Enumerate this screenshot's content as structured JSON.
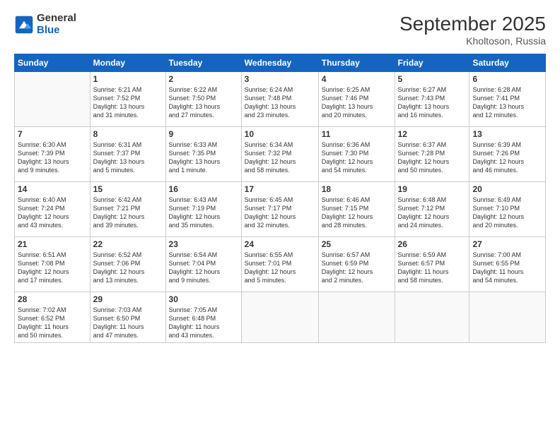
{
  "logo": {
    "general": "General",
    "blue": "Blue"
  },
  "header": {
    "month": "September 2025",
    "location": "Kholtoson, Russia"
  },
  "weekdays": [
    "Sunday",
    "Monday",
    "Tuesday",
    "Wednesday",
    "Thursday",
    "Friday",
    "Saturday"
  ],
  "weeks": [
    [
      {
        "day": "",
        "info": ""
      },
      {
        "day": "1",
        "info": "Sunrise: 6:21 AM\nSunset: 7:52 PM\nDaylight: 13 hours\nand 31 minutes."
      },
      {
        "day": "2",
        "info": "Sunrise: 6:22 AM\nSunset: 7:50 PM\nDaylight: 13 hours\nand 27 minutes."
      },
      {
        "day": "3",
        "info": "Sunrise: 6:24 AM\nSunset: 7:48 PM\nDaylight: 13 hours\nand 23 minutes."
      },
      {
        "day": "4",
        "info": "Sunrise: 6:25 AM\nSunset: 7:46 PM\nDaylight: 13 hours\nand 20 minutes."
      },
      {
        "day": "5",
        "info": "Sunrise: 6:27 AM\nSunset: 7:43 PM\nDaylight: 13 hours\nand 16 minutes."
      },
      {
        "day": "6",
        "info": "Sunrise: 6:28 AM\nSunset: 7:41 PM\nDaylight: 13 hours\nand 12 minutes."
      }
    ],
    [
      {
        "day": "7",
        "info": "Sunrise: 6:30 AM\nSunset: 7:39 PM\nDaylight: 13 hours\nand 9 minutes."
      },
      {
        "day": "8",
        "info": "Sunrise: 6:31 AM\nSunset: 7:37 PM\nDaylight: 13 hours\nand 5 minutes."
      },
      {
        "day": "9",
        "info": "Sunrise: 6:33 AM\nSunset: 7:35 PM\nDaylight: 13 hours\nand 1 minute."
      },
      {
        "day": "10",
        "info": "Sunrise: 6:34 AM\nSunset: 7:32 PM\nDaylight: 12 hours\nand 58 minutes."
      },
      {
        "day": "11",
        "info": "Sunrise: 6:36 AM\nSunset: 7:30 PM\nDaylight: 12 hours\nand 54 minutes."
      },
      {
        "day": "12",
        "info": "Sunrise: 6:37 AM\nSunset: 7:28 PM\nDaylight: 12 hours\nand 50 minutes."
      },
      {
        "day": "13",
        "info": "Sunrise: 6:39 AM\nSunset: 7:26 PM\nDaylight: 12 hours\nand 46 minutes."
      }
    ],
    [
      {
        "day": "14",
        "info": "Sunrise: 6:40 AM\nSunset: 7:24 PM\nDaylight: 12 hours\nand 43 minutes."
      },
      {
        "day": "15",
        "info": "Sunrise: 6:42 AM\nSunset: 7:21 PM\nDaylight: 12 hours\nand 39 minutes."
      },
      {
        "day": "16",
        "info": "Sunrise: 6:43 AM\nSunset: 7:19 PM\nDaylight: 12 hours\nand 35 minutes."
      },
      {
        "day": "17",
        "info": "Sunrise: 6:45 AM\nSunset: 7:17 PM\nDaylight: 12 hours\nand 32 minutes."
      },
      {
        "day": "18",
        "info": "Sunrise: 6:46 AM\nSunset: 7:15 PM\nDaylight: 12 hours\nand 28 minutes."
      },
      {
        "day": "19",
        "info": "Sunrise: 6:48 AM\nSunset: 7:12 PM\nDaylight: 12 hours\nand 24 minutes."
      },
      {
        "day": "20",
        "info": "Sunrise: 6:49 AM\nSunset: 7:10 PM\nDaylight: 12 hours\nand 20 minutes."
      }
    ],
    [
      {
        "day": "21",
        "info": "Sunrise: 6:51 AM\nSunset: 7:08 PM\nDaylight: 12 hours\nand 17 minutes."
      },
      {
        "day": "22",
        "info": "Sunrise: 6:52 AM\nSunset: 7:06 PM\nDaylight: 12 hours\nand 13 minutes."
      },
      {
        "day": "23",
        "info": "Sunrise: 6:54 AM\nSunset: 7:04 PM\nDaylight: 12 hours\nand 9 minutes."
      },
      {
        "day": "24",
        "info": "Sunrise: 6:55 AM\nSunset: 7:01 PM\nDaylight: 12 hours\nand 5 minutes."
      },
      {
        "day": "25",
        "info": "Sunrise: 6:57 AM\nSunset: 6:59 PM\nDaylight: 12 hours\nand 2 minutes."
      },
      {
        "day": "26",
        "info": "Sunrise: 6:59 AM\nSunset: 6:57 PM\nDaylight: 11 hours\nand 58 minutes."
      },
      {
        "day": "27",
        "info": "Sunrise: 7:00 AM\nSunset: 6:55 PM\nDaylight: 11 hours\nand 54 minutes."
      }
    ],
    [
      {
        "day": "28",
        "info": "Sunrise: 7:02 AM\nSunset: 6:52 PM\nDaylight: 11 hours\nand 50 minutes."
      },
      {
        "day": "29",
        "info": "Sunrise: 7:03 AM\nSunset: 6:50 PM\nDaylight: 11 hours\nand 47 minutes."
      },
      {
        "day": "30",
        "info": "Sunrise: 7:05 AM\nSunset: 6:48 PM\nDaylight: 11 hours\nand 43 minutes."
      },
      {
        "day": "",
        "info": ""
      },
      {
        "day": "",
        "info": ""
      },
      {
        "day": "",
        "info": ""
      },
      {
        "day": "",
        "info": ""
      }
    ]
  ]
}
